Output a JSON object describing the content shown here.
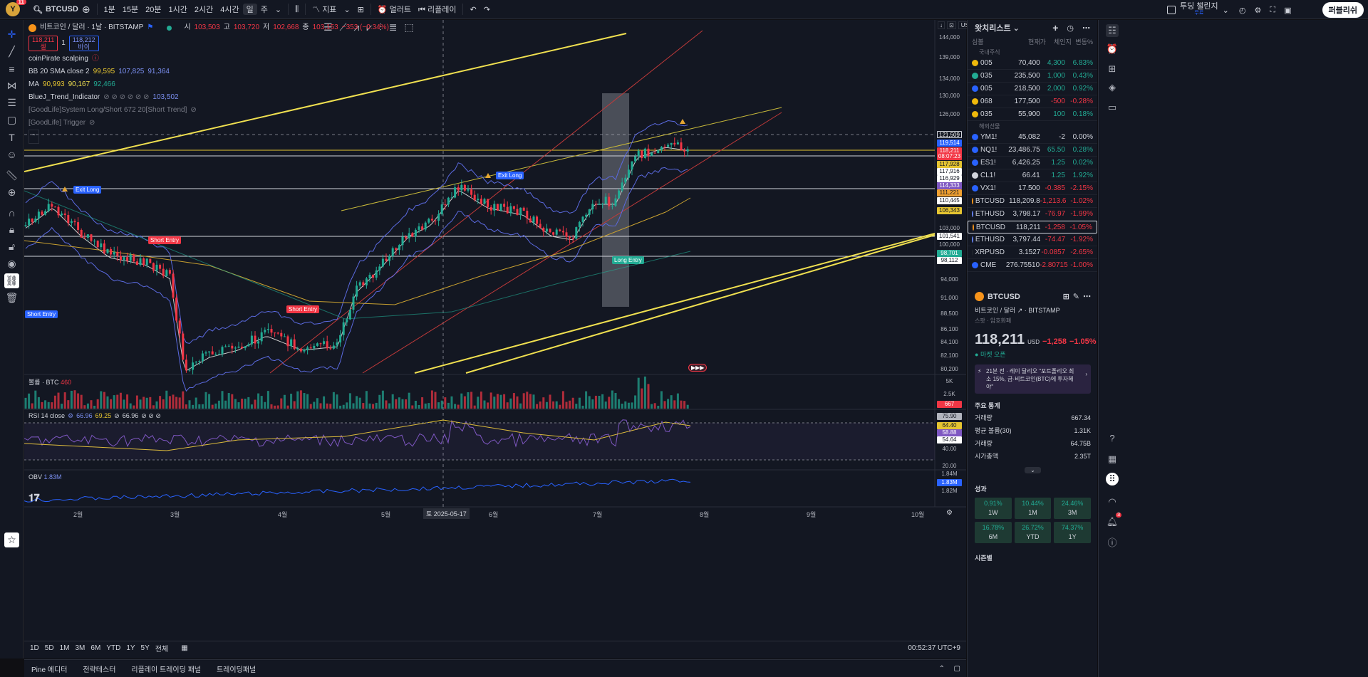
{
  "topbar": {
    "avatar_badge": "11",
    "symbol": "BTCUSD",
    "intervals": [
      "1분",
      "15분",
      "20분",
      "1시간",
      "2시간",
      "4시간",
      "일",
      "주"
    ],
    "indicators_label": "지표",
    "alert_label": "얼러트",
    "replay_label": "리플레이",
    "trading_challenge": "투딩 챌린지",
    "trading_challenge_sub": "무료",
    "publish_label": "퍼블리쉬"
  },
  "legend": {
    "title": "비트코인 / 달러 · 1날 · BITSTAMP",
    "open_label": "시",
    "open": "103,503",
    "high_label": "고",
    "high": "103,720",
    "low_label": "저",
    "low": "102,668",
    "close_label": "종",
    "close": "103,153",
    "change": "−353 (−0.34%)",
    "sell_price": "118,211",
    "sell_label": "셀",
    "buy_price": "118,212",
    "buy_label": "바이",
    "spread": "1",
    "ind1": "coinPirate scalping",
    "ind2_name": "BB 20 SMA close 2",
    "ind2_v1": "99,595",
    "ind2_v2": "107,825",
    "ind2_v3": "91,364",
    "ind3_name": "MA",
    "ind3_v1": "90,993",
    "ind3_v2": "90,167",
    "ind3_v3": "92,466",
    "ind4_name": "BlueJ_Trend_Indicator",
    "ind4_v": "103,502",
    "ind5": "[GoodLife]System Long/Short 672 20[Short Trend]",
    "ind6": "[GoodLife] Trigger"
  },
  "price_axis": {
    "currency": "USD",
    "ticks": [
      "144,000",
      "139,000",
      "134,000",
      "130,000",
      "126,000",
      "121,509",
      "119,514",
      "118,211",
      "08:07:23",
      "117,928",
      "117,916",
      "116,929",
      "114,333",
      "111,221",
      "110,445",
      "106,343",
      "103,000",
      "101,541",
      "100,000",
      "98,701",
      "98,112",
      "94,000",
      "91,000",
      "88,500",
      "86,100",
      "84,100",
      "82,100",
      "80,200"
    ]
  },
  "time_axis": {
    "labels": [
      "2월",
      "3월",
      "4월",
      "5월",
      "6월",
      "7월",
      "8월",
      "9월",
      "10월"
    ],
    "crosshair_label": "토 2025-05-17"
  },
  "chart_labels": {
    "exit_long_1": "Exit Long",
    "exit_long_2": "Exit Long",
    "short_entry_1": "Short Entry",
    "short_entry_2": "Short Entry",
    "short_entry_3": "Short Entry",
    "long_entry": "Long Entry"
  },
  "volume_pane": {
    "title": "볼륨 · BTC",
    "value": "460",
    "ticks": [
      "5K",
      "2.5K",
      "667"
    ]
  },
  "rsi_pane": {
    "title": "RSI 14 close",
    "v1": "66.96",
    "v2": "69.25",
    "v3": "66.96",
    "ticks": [
      "75.90",
      "64.40",
      "58.88",
      "54.64",
      "40.00",
      "20.00"
    ]
  },
  "obv_pane": {
    "title": "OBV",
    "value": "1.83M",
    "ticks": [
      "1.84M",
      "1.83M",
      "1.82M"
    ]
  },
  "tf_bar": {
    "ranges": [
      "1D",
      "5D",
      "1M",
      "3M",
      "6M",
      "YTD",
      "1Y",
      "5Y",
      "전체"
    ],
    "clock": "00:52:37 UTC+9"
  },
  "bottom_tabs": [
    "Pine 에디터",
    "전략테스터",
    "리플레이 트레이딩 패널",
    "트레이딩패널"
  ],
  "watchlist": {
    "title": "왓치리스트",
    "cols": [
      "심볼",
      "현재가",
      "체인지",
      "변동%"
    ],
    "group1": "국내주식",
    "group2": "해외선물",
    "rows": [
      {
        "sym": "005",
        "price": "70,400",
        "chg": "4,300",
        "pct": "6.83%",
        "dir": "up",
        "color": "#f0b90b"
      },
      {
        "sym": "035",
        "price": "235,500",
        "chg": "1,000",
        "pct": "0.43%",
        "dir": "up",
        "color": "#22ab94"
      },
      {
        "sym": "005",
        "price": "218,500",
        "chg": "2,000",
        "pct": "0.92%",
        "dir": "up",
        "color": "#2962ff"
      },
      {
        "sym": "068",
        "price": "177,500",
        "chg": "-500",
        "pct": "-0.28%",
        "dir": "down",
        "color": "#f0b90b"
      },
      {
        "sym": "035",
        "price": "55,900",
        "chg": "100",
        "pct": "0.18%",
        "dir": "up",
        "color": "#f0b90b"
      },
      {
        "sym": "YM1!",
        "price": "45,082",
        "chg": "-2",
        "pct": "0.00%",
        "dir": "flat",
        "color": "#2962ff"
      },
      {
        "sym": "NQ1!",
        "price": "23,486.75",
        "chg": "65.50",
        "pct": "0.28%",
        "dir": "up",
        "color": "#2962ff"
      },
      {
        "sym": "ES1!",
        "price": "6,426.25",
        "chg": "1.25",
        "pct": "0.02%",
        "dir": "up",
        "color": "#2962ff"
      },
      {
        "sym": "CL1!",
        "price": "66.41",
        "chg": "1.25",
        "pct": "1.92%",
        "dir": "up",
        "color": "#d1d4dc"
      },
      {
        "sym": "VX1!",
        "price": "17.500",
        "chg": "-0.385",
        "pct": "-2.15%",
        "dir": "down",
        "color": "#2962ff"
      },
      {
        "sym": "BTCUSD",
        "price": "118,209.8",
        "chg": "-1,213.6",
        "pct": "-1.02%",
        "dir": "down",
        "color": "#f7931a"
      },
      {
        "sym": "ETHUSD",
        "price": "3,798.17",
        "chg": "-76.97",
        "pct": "-1.99%",
        "dir": "down",
        "color": "#627eea"
      },
      {
        "sym": "BTCUSD",
        "price": "118,211",
        "chg": "-1,258",
        "pct": "-1.05%",
        "dir": "down",
        "color": "#f7931a"
      },
      {
        "sym": "ETHUSD",
        "price": "3,797.44",
        "chg": "-74.47",
        "pct": "-1.92%",
        "dir": "down",
        "color": "#627eea"
      },
      {
        "sym": "XRPUSD",
        "price": "3.1527",
        "chg": "-0.0857",
        "pct": "-2.65%",
        "dir": "down",
        "color": "#23292f"
      },
      {
        "sym": "CME",
        "price": "276.75510",
        "chg": "-2.80715",
        "pct": "-1.00%",
        "dir": "down",
        "color": "#2962ff"
      }
    ]
  },
  "detail": {
    "symbol": "BTCUSD",
    "name": "비트코인 / 달러",
    "exchange": "BITSTAMP",
    "type": "스팟 · 암호화폐",
    "price": "118,211",
    "currency": "USD",
    "change": "−1,258",
    "change_pct": "−1.05%",
    "market_status": "마켓 오픈",
    "news": "21분 전 · 레이 달리오 \"포트폴리오 최소 15%, 금·비트코인(BTC)에 투자해야\"",
    "stats_title": "주요 통계",
    "stats": [
      {
        "label": "거래량",
        "value": "667.34"
      },
      {
        "label": "평균 볼륨(30)",
        "value": "1.31K"
      },
      {
        "label": "거래량",
        "value": "64.75B"
      },
      {
        "label": "시가총액",
        "value": "2.35T"
      }
    ],
    "perf_title": "성과",
    "perf": [
      {
        "v": "0.91%",
        "l": "1W"
      },
      {
        "v": "10.44%",
        "l": "1M"
      },
      {
        "v": "24.46%",
        "l": "3M"
      },
      {
        "v": "16.78%",
        "l": "6M"
      },
      {
        "v": "26.72%",
        "l": "YTD"
      },
      {
        "v": "74.37%",
        "l": "1Y"
      }
    ],
    "season_title": "시즌별"
  },
  "rightbar_badge": "3"
}
